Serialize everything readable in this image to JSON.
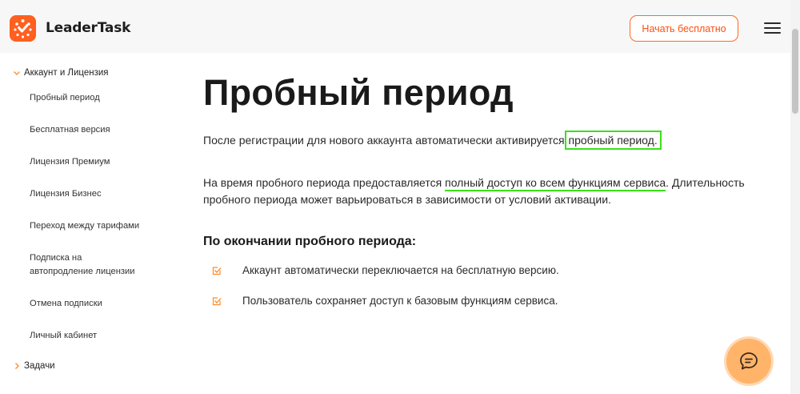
{
  "header": {
    "brand": "LeaderTask",
    "cta_label": "Начать бесплатно",
    "menu_icon": "hamburger-icon",
    "logo_icon": "leadertask-logo"
  },
  "colors": {
    "accent": "#ff5f1f",
    "highlight": "#3be01a",
    "chat": "#ffb46a"
  },
  "sidebar": {
    "section_open": "Аккаунт и Лицензия",
    "items": [
      "Пробный период",
      "Бесплатная версия",
      "Лицензия Премиум",
      "Лицензия Бизнес",
      "Переход между тарифами",
      "Подписка на",
      "автопродление лицензии",
      "Отмена подписки",
      "Личный кабинет"
    ],
    "section_closed": "Задачи"
  },
  "main": {
    "title": "Пробный период",
    "p1_text": "После регистрации для нового аккаунта автоматически активируется ",
    "p1_highlight": "пробный период.",
    "p2_before": "На время пробного периода предоставляется ",
    "p2_highlight": "полный доступ ко всем функциям сервиса",
    "p2_after": ". Длительность",
    "p2_line2": "пробного периода может варьироваться в зависимости от условий активации.",
    "subheading": "По окончании пробного периода:",
    "bullets": [
      "Аккаунт автоматически переключается на бесплатную версию.",
      "Пользователь сохраняет доступ к базовым функциям сервиса."
    ]
  },
  "chat": {
    "icon": "chat-bubble-icon"
  }
}
